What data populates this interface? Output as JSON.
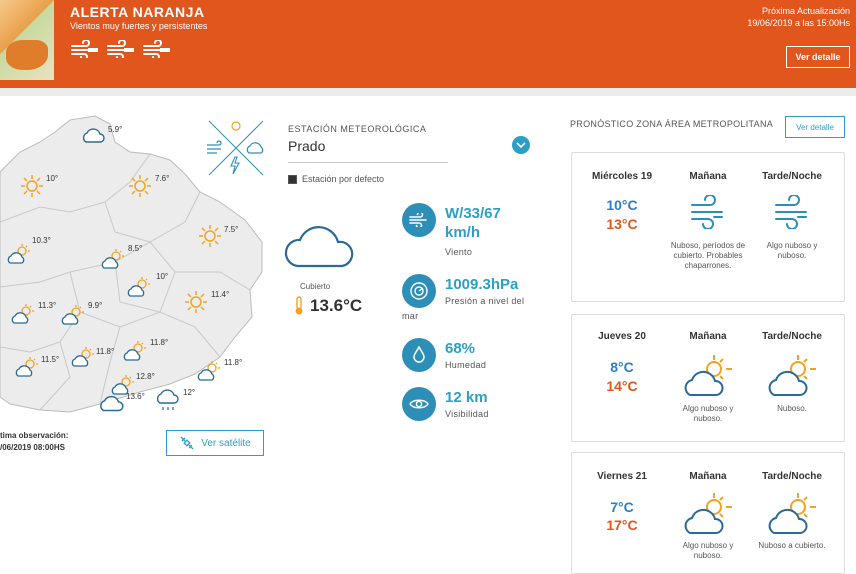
{
  "alert": {
    "title": "ALERTA NARANJA",
    "subtitle": "Vientos muy fuertes y persistentes",
    "next_update_label": "Próxima Actualización",
    "next_update_value": "19/06/2019 a las 15:00Hs",
    "detail_button": "Ver detalle",
    "color": "#e0561d"
  },
  "map": {
    "labels": [
      {
        "id": "m1",
        "text": "5.9°",
        "icon": "cloud"
      },
      {
        "id": "m2",
        "text": "10°",
        "icon": "sun"
      },
      {
        "id": "m3",
        "text": "7.6°",
        "icon": "sun"
      },
      {
        "id": "m4",
        "text": "10.3°",
        "icon": "partly-cloudy"
      },
      {
        "id": "m5",
        "text": "8.5°",
        "icon": "partly-cloudy"
      },
      {
        "id": "m6",
        "text": "7.5°",
        "icon": "sun"
      },
      {
        "id": "m7",
        "text": "10°",
        "icon": "partly-cloudy"
      },
      {
        "id": "m8",
        "text": "11.4°",
        "icon": "sun"
      },
      {
        "id": "m9",
        "text": "11.3°",
        "icon": "partly-cloudy"
      },
      {
        "id": "m10",
        "text": "9.9°",
        "icon": "partly-cloudy"
      },
      {
        "id": "m11",
        "text": "11.8°",
        "icon": "partly-cloudy"
      },
      {
        "id": "m12",
        "text": "11.8°",
        "icon": "partly-cloudy"
      },
      {
        "id": "m13",
        "text": "11.5°",
        "icon": "partly-cloudy"
      },
      {
        "id": "m14",
        "text": "11.8°",
        "icon": "partly-cloudy"
      },
      {
        "id": "m15",
        "text": "12.8°",
        "icon": "partly-cloudy"
      },
      {
        "id": "m16",
        "text": "13.6°",
        "icon": "cloud"
      },
      {
        "id": "m17",
        "text": "12°",
        "icon": "rain"
      }
    ],
    "observation_label": "tima observación:",
    "observation_value": "/06/2019 08:00HS",
    "satellite_button": "Ver satélite"
  },
  "station": {
    "label": "ESTACIÓN METEOROLÓGICA",
    "selected": "Prado",
    "default_label": "Estación por defecto",
    "current_desc": "Cubierto",
    "current_temp": "13.6°C"
  },
  "metrics": [
    {
      "icon": "wind-icon",
      "value_line1": "W/33/67",
      "value_line2": "km/h",
      "label": "Viento"
    },
    {
      "icon": "pressure-icon",
      "value_line1": "1009.3hPa",
      "label_line1": "Presión a nivel del",
      "label_line2": "mar"
    },
    {
      "icon": "drop-icon",
      "value_line1": "68%",
      "label": "Humedad"
    },
    {
      "icon": "eye-icon",
      "value_line1": "12 km",
      "label": "Visibilidad"
    }
  ],
  "forecast": {
    "heading": "PRONÓSTICO ZONA ÁREA METROPOLITANA",
    "detail_button": "Ver detalle",
    "morning_header": "Mañana",
    "evening_header": "Tarde/Noche",
    "days": [
      {
        "day": "Miércoles 19",
        "min": "10°C",
        "max": "13°C",
        "morning_icon": "wind-icon",
        "morning_desc": "Nuboso, períodos de cubierto. Probables chaparrones.",
        "evening_icon": "wind-icon",
        "evening_desc": "Algo nuboso y nuboso."
      },
      {
        "day": "Jueves 20",
        "min": "8°C",
        "max": "14°C",
        "morning_icon": "partly-cloudy-icon",
        "morning_desc": "Algo nuboso y nuboso.",
        "evening_icon": "partly-cloudy-icon",
        "evening_desc": "Nuboso."
      },
      {
        "day": "Viernes 21",
        "min": "7°C",
        "max": "17°C",
        "morning_icon": "partly-cloudy-icon",
        "morning_desc": "Algo nuboso y nuboso.",
        "evening_icon": "partly-cloudy-icon",
        "evening_desc": "Nuboso a cubierto."
      }
    ]
  }
}
